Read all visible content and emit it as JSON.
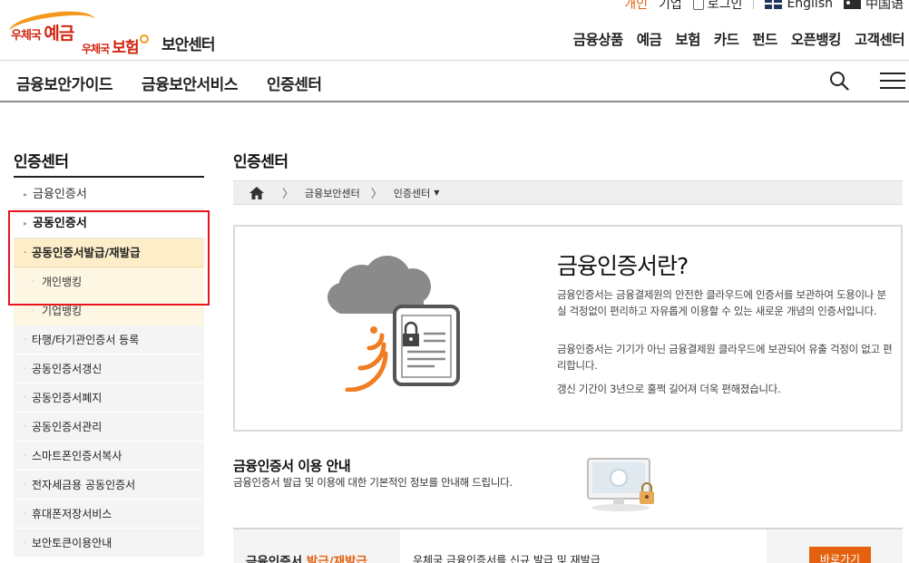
{
  "top_links": {
    "personal": "개인",
    "business": "기업",
    "login": "로그인",
    "english": "English",
    "chinese": "中国语"
  },
  "logo": {
    "line1_prefix": "우체국",
    "line1_main": "예금",
    "line2_prefix": "우체국",
    "line2_main": "보험"
  },
  "site_name": "보안센터",
  "main_nav": [
    "금융상품",
    "예금",
    "보험",
    "카드",
    "펀드",
    "오픈뱅킹",
    "고객센터"
  ],
  "sub_nav": [
    "금융보안가이드",
    "금융보안서비스",
    "인증센터"
  ],
  "sidebar": {
    "title": "인증센터",
    "items": [
      "금융인증서",
      "공동인증서",
      "공동인증서발급/재발급",
      "개인뱅킹",
      "기업뱅킹",
      "타행/타기관인증서 등록",
      "공동인증서갱신",
      "공동인증서폐지",
      "공동인증서관리",
      "스마트폰인증서복사",
      "전자세금용 공동인증서",
      "휴대폰저장서비스",
      "보안토큰이용안내"
    ]
  },
  "page": {
    "title": "인증센터",
    "breadcrumb": [
      "금융보안센터",
      "인증센터"
    ]
  },
  "hero": {
    "title": "금융인증서란?",
    "p1": "금융인증서는 금융결제원의 안전한 클라우드에 인증서를 보관하여 도용이나 분실 걱정없이 편리하고 자유롭게 이용할 수 있는 새로운 개념의 인증서입니다.",
    "p2": "금융인증서는 기기가 아닌 금융결제원 클라우드에 보관되어 유출 걱정이 없고 편리합니다.",
    "p3": "갱신 기간이 3년으로 훌쩍 길어져 더욱 편해졌습니다."
  },
  "guide": {
    "title": "금융인증서 이용 안내",
    "desc": "금융인증서 발급 및 이용에 대한 기본적인 정보를 안내해 드립니다."
  },
  "info_row": {
    "left_prefix": "금융인증서",
    "left_highlight": "발급/재발급",
    "mid": "우체국 금융인증서를 신규 발급 및 재발급",
    "button": "바로가기"
  },
  "colors": {
    "accent": "#e4610f",
    "highlight_bg": "#fdedc9",
    "red_box": "#e8141c"
  },
  "icons": [
    "lock-icon",
    "uk-flag-icon",
    "china-flag-icon",
    "search-icon",
    "menu-icon",
    "home-icon",
    "chevron-right-icon",
    "caret-down-icon",
    "cloud-certificate-illustration",
    "monitor-lock-illustration"
  ]
}
